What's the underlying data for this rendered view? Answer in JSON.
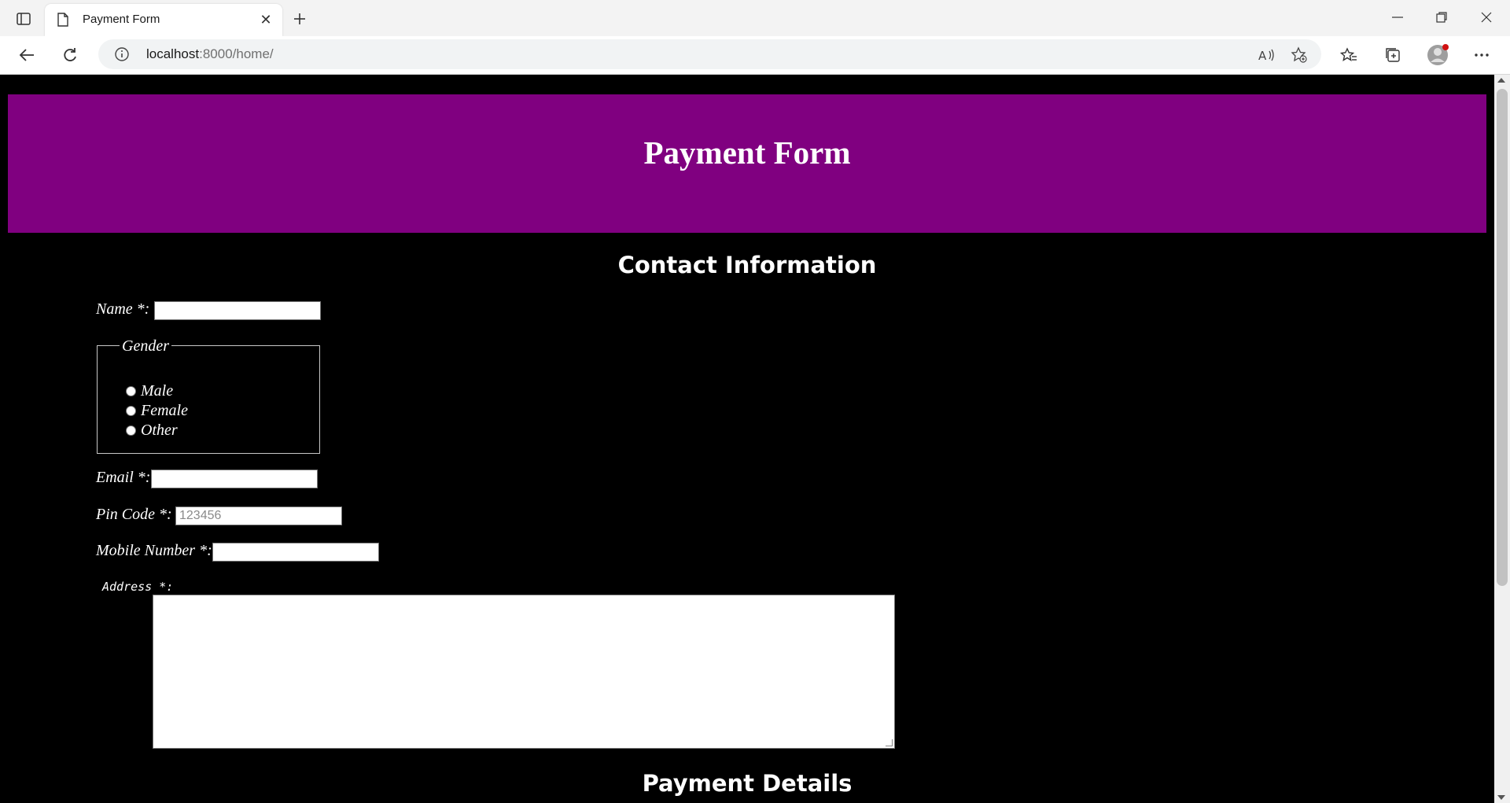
{
  "browser": {
    "tab_title": "Payment Form",
    "address_host": "localhost",
    "address_rest": ":8000/home/"
  },
  "page": {
    "header_title": "Payment Form",
    "contact_section_title": "Contact Information",
    "payment_section_title": "Payment Details",
    "name_label": "Name *:",
    "name_value": "",
    "gender_legend": "Gender",
    "gender_options": [
      "Male",
      "Female",
      "Other"
    ],
    "email_label": "Email *:",
    "email_value": "",
    "pincode_label": "Pin Code *:",
    "pincode_placeholder": "123456",
    "mobile_label": "Mobile Number *:",
    "mobile_value": "",
    "address_label": "Address *:",
    "address_value": ""
  },
  "colors": {
    "header_bg": "#800080",
    "page_bg": "#000000",
    "text": "#ffffff"
  }
}
